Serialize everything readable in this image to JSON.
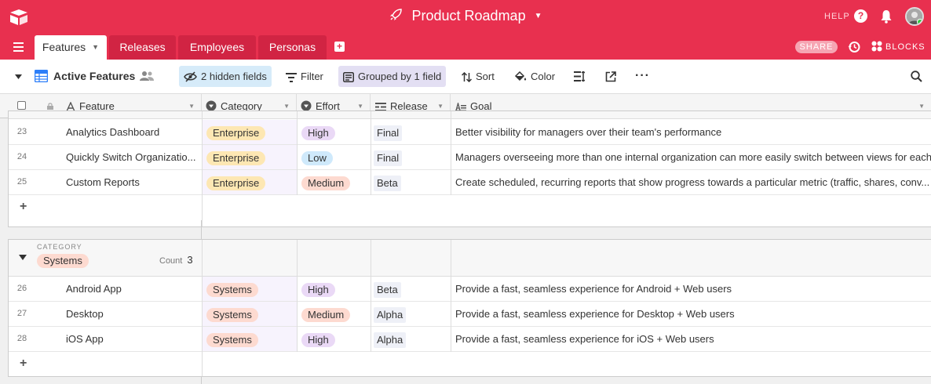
{
  "app": {
    "title": "Product Roadmap",
    "help_label": "HELP",
    "share_label": "SHARE",
    "blocks_label": "BLOCKS"
  },
  "tabs": [
    {
      "label": "Features",
      "active": true
    },
    {
      "label": "Releases",
      "active": false
    },
    {
      "label": "Employees",
      "active": false
    },
    {
      "label": "Personas",
      "active": false
    }
  ],
  "toolbar": {
    "view_name": "Active Features",
    "hidden_fields": "2 hidden fields",
    "filter": "Filter",
    "grouped": "Grouped by 1 field",
    "sort": "Sort",
    "color": "Color"
  },
  "columns": {
    "feature": "Feature",
    "category": "Category",
    "effort": "Effort",
    "release": "Release",
    "goal": "Goal"
  },
  "group_enterprise": {
    "rows": [
      {
        "num": "23",
        "feature": "Analytics Dashboard",
        "category": "Enterprise",
        "effort": "High",
        "release": "Final",
        "goal": "Better visibility for managers over their team's performance"
      },
      {
        "num": "24",
        "feature": "Quickly Switch Organizatio...",
        "category": "Enterprise",
        "effort": "Low",
        "release": "Final",
        "goal": "Managers overseeing more than one internal organization can more easily switch between views for each"
      },
      {
        "num": "25",
        "feature": "Custom Reports",
        "category": "Enterprise",
        "effort": "Medium",
        "release": "Beta",
        "goal": "Create scheduled, recurring reports that show progress towards a particular metric (traffic, shares, conv..."
      }
    ]
  },
  "group_systems": {
    "label": "CATEGORY",
    "value": "Systems",
    "count_label": "Count",
    "count": "3",
    "rows": [
      {
        "num": "26",
        "feature": "Android App",
        "category": "Systems",
        "effort": "High",
        "release": "Beta",
        "goal": "Provide a fast, seamless experience for Android + Web users"
      },
      {
        "num": "27",
        "feature": "Desktop",
        "category": "Systems",
        "effort": "Medium",
        "release": "Alpha",
        "goal": "Provide a fast, seamless experience for Desktop + Web users"
      },
      {
        "num": "28",
        "feature": "iOS App",
        "category": "Systems",
        "effort": "High",
        "release": "Alpha",
        "goal": "Provide a fast, seamless experience for iOS + Web users"
      }
    ]
  },
  "add_row_glyph": "+",
  "colors": {
    "brand": "#e8304f",
    "enterprise": "#fde7b3",
    "systems": "#fddad0",
    "high": "#ead9f6",
    "low": "#cfe9fb",
    "medium": "#fddad0"
  },
  "icons": [
    "base-logo-icon",
    "rocket-icon",
    "help-icon",
    "bell-icon",
    "menu-icon",
    "add-tab-icon",
    "history-icon",
    "blocks-icon",
    "grid-view-icon",
    "people-icon",
    "hide-fields-icon",
    "filter-icon",
    "group-icon",
    "sort-icon",
    "color-icon",
    "row-height-icon",
    "share-view-icon",
    "more-icon",
    "search-icon"
  ]
}
